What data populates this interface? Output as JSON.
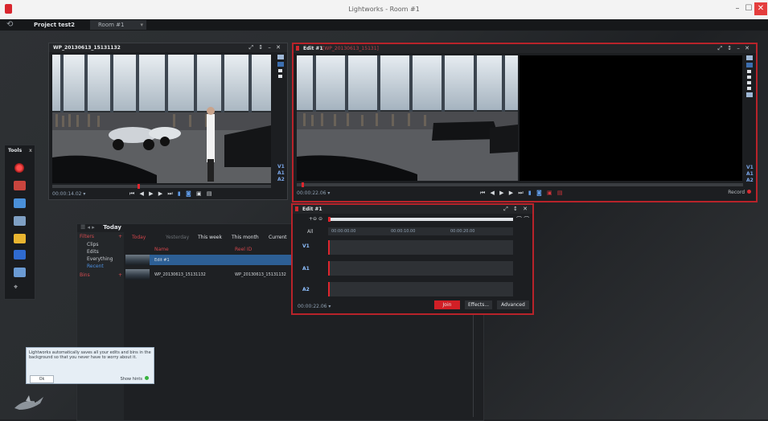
{
  "window": {
    "title": "Lightworks - Room #1",
    "min": "–",
    "max": "☐",
    "close": "✕"
  },
  "project": {
    "back": "⟲",
    "name": "Project test2",
    "room": "Room #1",
    "room_caret": "▾"
  },
  "source_viewer": {
    "title": "WP_20130613_15131132",
    "controls": "⤢ ↕ – ✕",
    "timecode": "00:00:14.02 ▾",
    "transport": "⏮ ◀ ▶ ▶ ⏭",
    "tracks": [
      "V1",
      "A1",
      "A2"
    ],
    "playhead_fraction": 0.39
  },
  "edit_viewer": {
    "title": "Edit #1",
    "subtitle": "[WP_20130613_15131]",
    "controls": "⤢ ↕ – ✕",
    "timecode": "00:00:22.06 ▾",
    "transport": "⏮ ◀ ▶ ▶ ⏭",
    "tracks": [
      "V1",
      "A1",
      "A2"
    ],
    "record_label": "Record",
    "playhead_fraction": 0.01
  },
  "tools": {
    "label": "Tools",
    "close": "x",
    "items": [
      "record-tool",
      "sync-tool",
      "edit-tool",
      "viewer-tool",
      "bin-tool",
      "effects-tool",
      "export-tool",
      "marks-tool"
    ]
  },
  "bins": {
    "nav": "☰ ◂ ▸",
    "title": "Today",
    "filters_label": "Filters",
    "filter_items": [
      "Clips",
      "Edits",
      "Everything",
      "Recent"
    ],
    "bins_label": "Bins",
    "plus": "+",
    "tabs": [
      "Today",
      "Yesterday",
      "This week",
      "This month",
      "Current"
    ],
    "col_name": "Name",
    "col_reel": "Reel ID",
    "rows": [
      {
        "name": "Edit #1",
        "reel": ""
      },
      {
        "name": "WP_20130613_15131132",
        "reel": "WP_20130613_15131132"
      }
    ]
  },
  "tip": {
    "text": "Lightworks automatically saves all your edits and bins in the background so that you never have to worry about it.",
    "ok": "Ok",
    "hints": "Show hints"
  },
  "timeline": {
    "title": "Edit #1",
    "controls": "⤢ ↕ ✕",
    "zoom": "+⊖ ⊝",
    "end": "⌒ ⌒",
    "all_label": "All",
    "ruler": [
      "00:00:00.00",
      "00:00:10.00",
      "00:00:20.00"
    ],
    "tracks": [
      "V1",
      "A1",
      "A2"
    ],
    "timecode": "00:00:22.06 ▾",
    "join": "Join",
    "effects": "Effects...",
    "advanced": "Advanced"
  }
}
